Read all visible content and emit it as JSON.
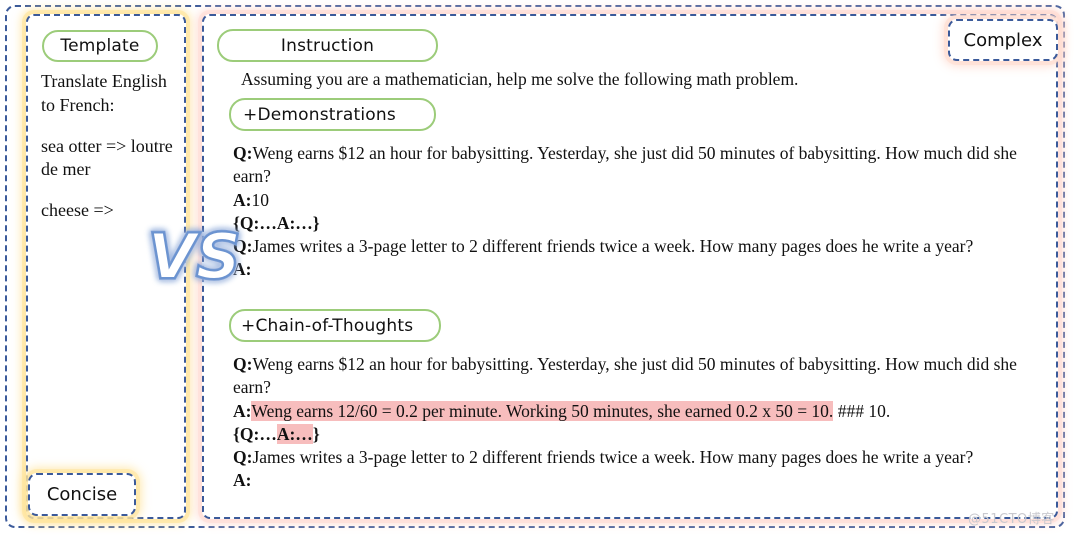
{
  "colors": {
    "frame_border": "#3b5a9a",
    "label_green": "#9ccc7a",
    "highlight_pink": "#f7bdbd",
    "left_glow_yellow": "#ffe296",
    "right_glow_pink": "#ffd6cd",
    "vs_blue": "#7c9fd6"
  },
  "left_panel": {
    "label": "Template",
    "badge": "Concise",
    "lines": [
      "Translate English to French:",
      "sea otter => loutre de mer",
      "cheese =>"
    ]
  },
  "vs": {
    "text": "VS"
  },
  "right_panel": {
    "badge": "Complex",
    "instruction": {
      "label": "Instruction",
      "text": "Assuming you are a mathematician, help me solve the following math problem."
    },
    "demonstrations": {
      "label": "+Demonstrations",
      "lines": [
        {
          "prefix": "Q:",
          "text": "Weng earns $12 an hour for babysitting. Yesterday, she just did 50 minutes of babysitting. How much did she earn?"
        },
        {
          "prefix": "A:",
          "text": "10"
        },
        {
          "prefix": "",
          "text": "{Q:…A:…}"
        },
        {
          "prefix": "Q:",
          "text": "James writes a 3-page letter to 2 different friends twice a week. How many pages does he write a year?"
        },
        {
          "prefix": "A:",
          "text": ""
        }
      ]
    },
    "chain_of_thoughts": {
      "label": "+Chain-of-Thoughts",
      "lines": [
        {
          "prefix": "Q:",
          "text": "Weng earns $12 an hour for babysitting. Yesterday, she just did 50 minutes of babysitting. How much did she earn?"
        },
        {
          "prefix": "A:",
          "highlighted": "Weng earns 12/60 = 0.2 per minute. Working 50 minutes, she earned 0.2 x 50 = 10.",
          "tail": " ### 10."
        },
        {
          "prefix": "",
          "text": "{Q:…A:…}"
        },
        {
          "prefix": "Q:",
          "text": "James writes a 3-page letter to 2 different friends twice a week. How many pages does he write a year?"
        },
        {
          "prefix": "A:",
          "text": ""
        }
      ]
    }
  },
  "watermark": "@51CTO博客"
}
